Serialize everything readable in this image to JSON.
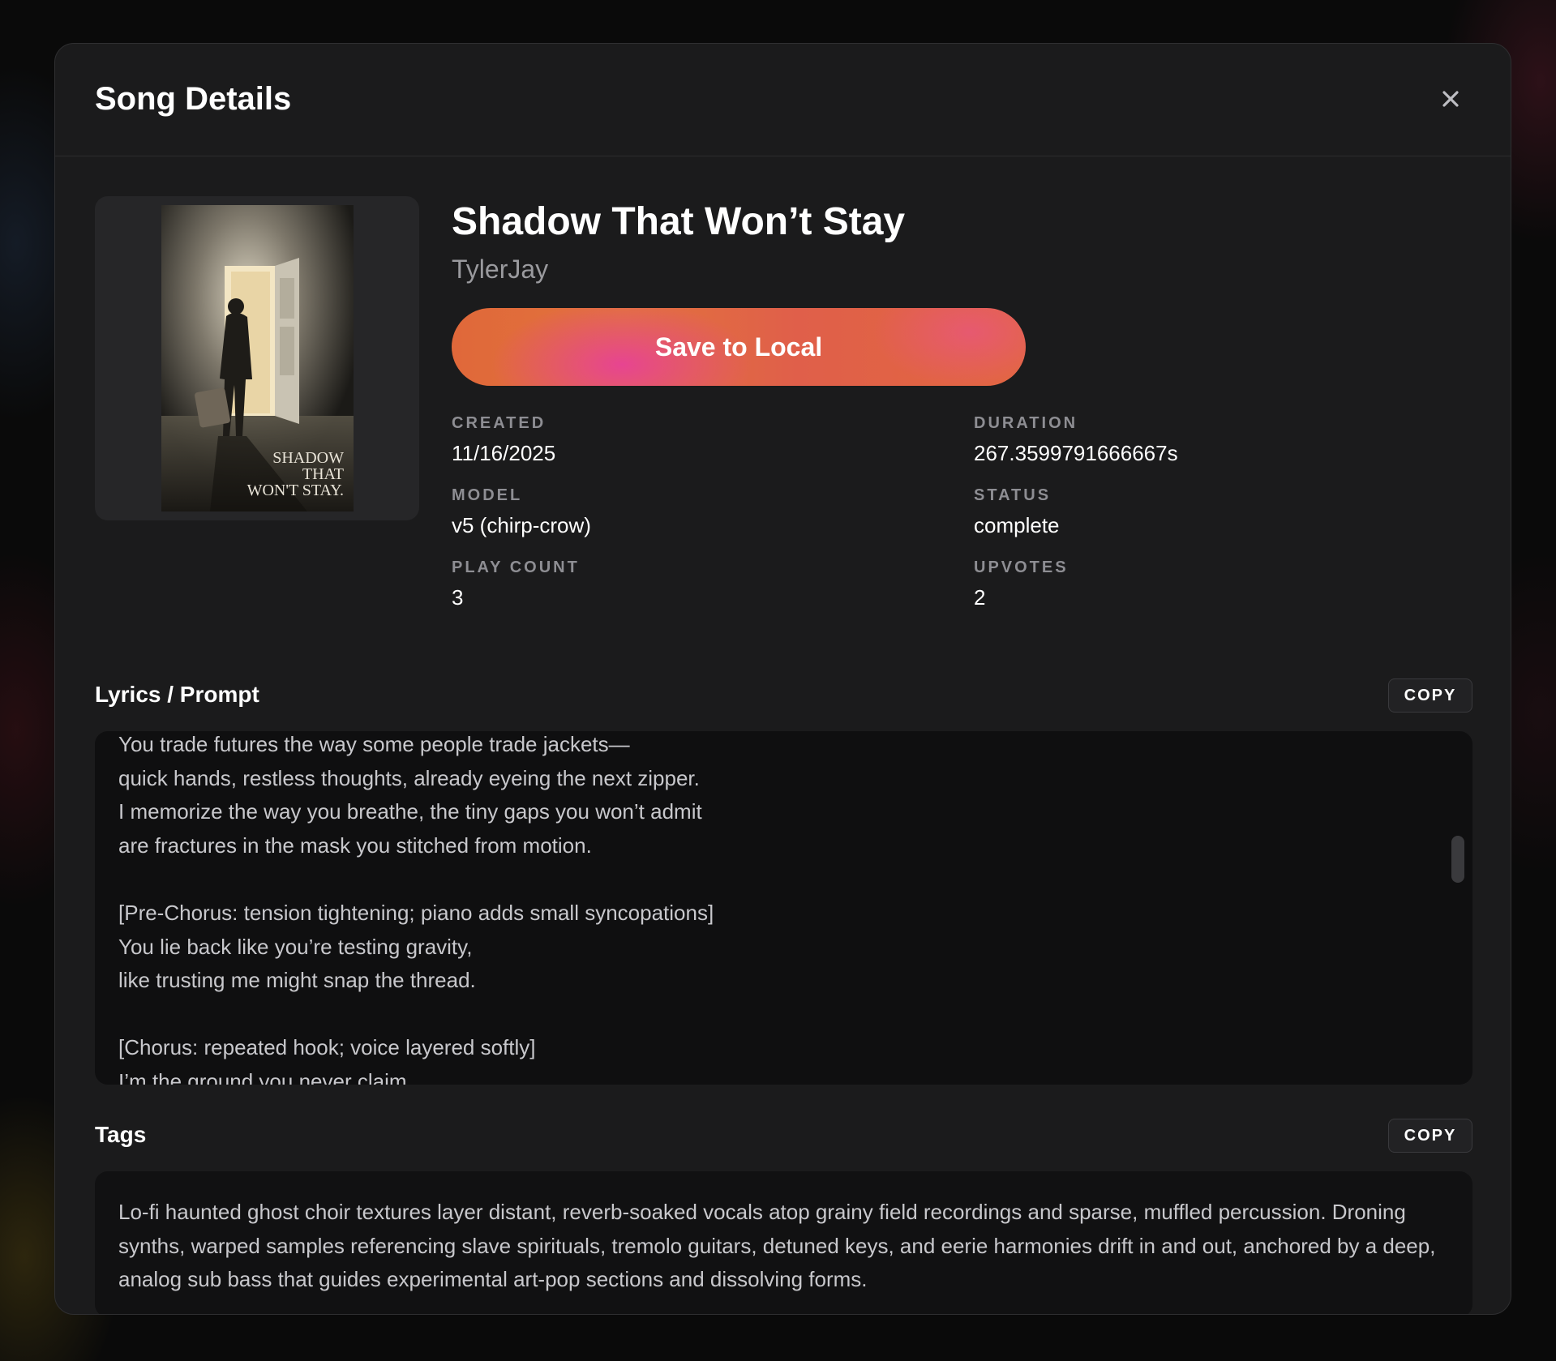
{
  "modal": {
    "title": "Song Details",
    "close_icon": "close-icon"
  },
  "song": {
    "title": "Shadow That Won’t Stay",
    "artist": "TylerJay",
    "save_label": "Save to Local",
    "cover_text_lines": [
      "SHADOW",
      "THAT",
      "WON'T STAY."
    ]
  },
  "meta": {
    "created": {
      "label": "CREATED",
      "value": "11/16/2025"
    },
    "duration": {
      "label": "DURATION",
      "value": "267.3599791666667s"
    },
    "model": {
      "label": "MODEL",
      "value": "v5 (chirp-crow)"
    },
    "status": {
      "label": "STATUS",
      "value": "complete"
    },
    "play_count": {
      "label": "PLAY COUNT",
      "value": "3"
    },
    "upvotes": {
      "label": "UPVOTES",
      "value": "2"
    }
  },
  "lyrics": {
    "title": "Lyrics / Prompt",
    "copy_label": "COPY",
    "text": "You trade futures the way some people trade jackets—\nquick hands, restless thoughts, already eyeing the next zipper.\nI memorize the way you breathe, the tiny gaps you won’t admit\nare fractures in the mask you stitched from motion.\n\n[Pre-Chorus: tension tightening; piano adds small syncopations]\nYou lie back like you’re testing gravity,\nlike trusting me might snap the thread.\n\n[Chorus: repeated hook; voice layered softly]\nI’m the ground you never claim"
  },
  "tags": {
    "title": "Tags",
    "copy_label": "COPY",
    "text": "Lo-fi haunted ghost choir textures layer distant, reverb-soaked vocals atop grainy field recordings and sparse, muffled percussion. Droning synths, warped samples referencing slave spirituals, tremolo guitars, detuned keys, and eerie harmonies drift in and out, anchored by a deep, analog sub bass that guides experimental art-pop sections and dissolving forms."
  },
  "colors": {
    "modal_bg": "#1b1b1c",
    "accent_orange": "#e2733c",
    "accent_pink": "#e83ca0",
    "muted_text": "#8e8e93"
  }
}
